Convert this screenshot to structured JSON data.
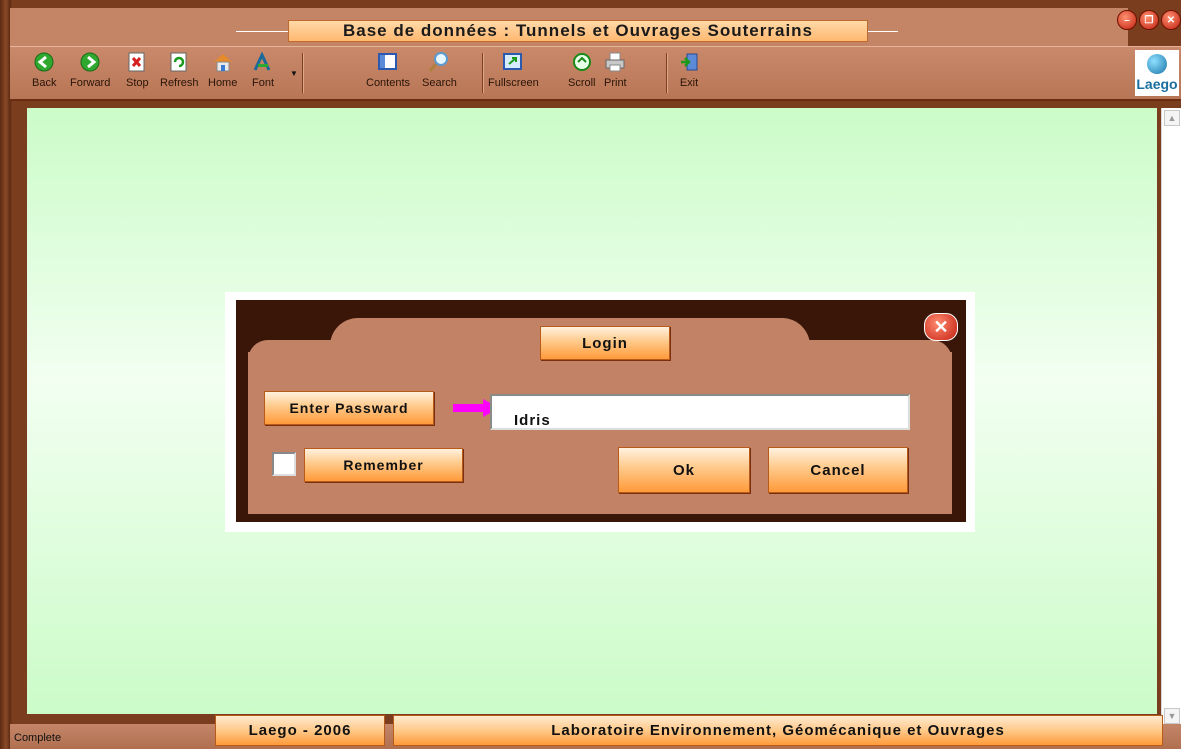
{
  "window": {
    "title": "Base de données : Tunnels et Ouvrages Souterrains",
    "controls": [
      "minimize",
      "restore",
      "close"
    ]
  },
  "toolbar": {
    "items": [
      {
        "label": "Back",
        "icon": "back-arrow-icon"
      },
      {
        "label": "Forward",
        "icon": "forward-arrow-icon"
      },
      {
        "label": "Stop",
        "icon": "stop-icon"
      },
      {
        "label": "Refresh",
        "icon": "refresh-icon"
      },
      {
        "label": "Home",
        "icon": "home-icon"
      },
      {
        "label": "Font",
        "icon": "font-icon"
      },
      {
        "label": "Contents",
        "icon": "contents-icon"
      },
      {
        "label": "Search",
        "icon": "search-icon"
      },
      {
        "label": "Fullscreen",
        "icon": "fullscreen-icon"
      },
      {
        "label": "Scroll",
        "icon": "scroll-icon"
      },
      {
        "label": "Print",
        "icon": "print-icon"
      },
      {
        "label": "Exit",
        "icon": "exit-icon"
      }
    ],
    "logo_text": "Laego"
  },
  "dialog": {
    "title": "Login",
    "password_label": "Enter Passward",
    "password_value": "Idris",
    "remember_label": "Remember",
    "remember_checked": false,
    "ok_label": "Ok",
    "cancel_label": "Cancel"
  },
  "status": {
    "text": "Complete"
  },
  "footer": {
    "left": "Laego - 2006",
    "right": "Laboratoire Environnement, Géomécanique et Ouvrages"
  },
  "colors": {
    "wood": "#c18266",
    "dark_wood": "#3a1608",
    "accent_orange": "#ff9a3a",
    "content_bg": "#cbfcc8",
    "arrow": "#ff00ff"
  }
}
